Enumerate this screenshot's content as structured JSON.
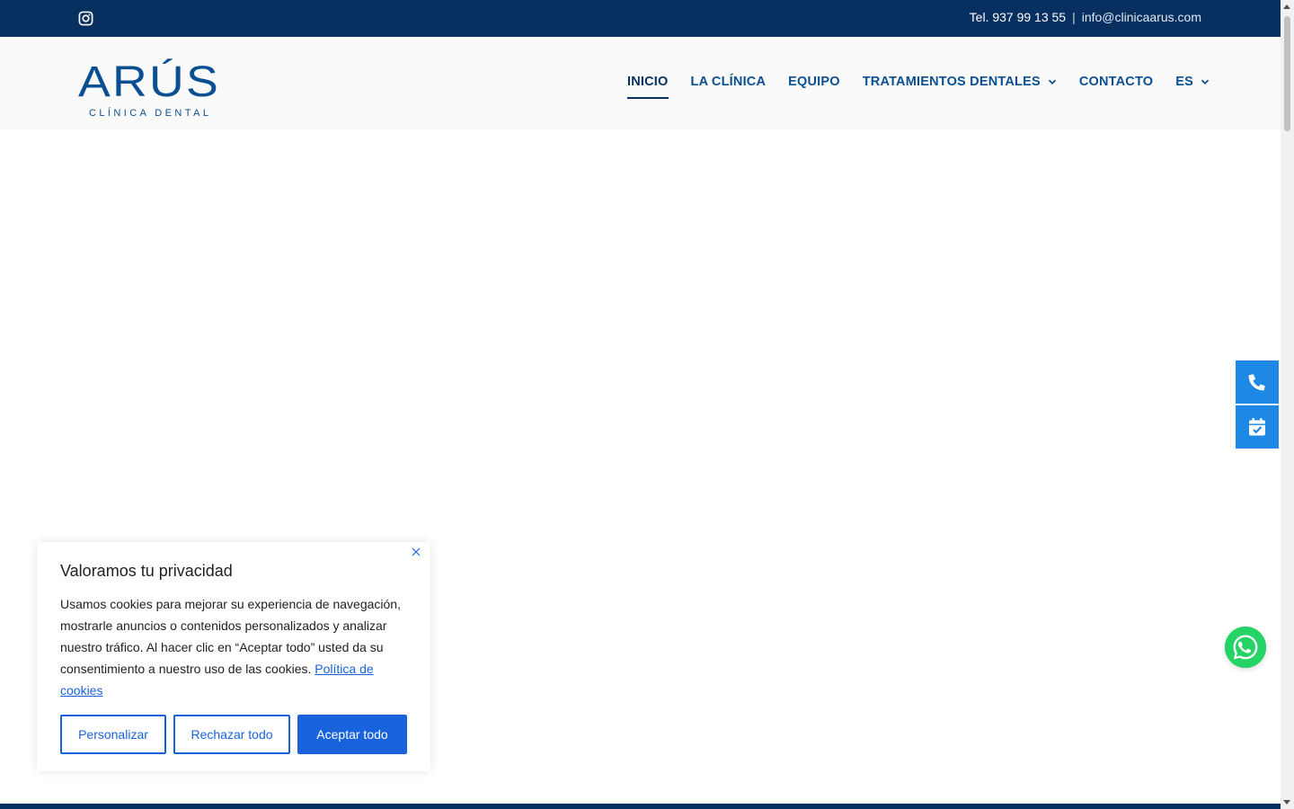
{
  "topbar": {
    "phone": "Tel. 937 99 13 55",
    "separator": "|",
    "email": "info@clinicaarus.com",
    "social_icon": "instagram-icon"
  },
  "header": {
    "logo_text": "ARÚS",
    "logo_subtext": "CLÍNICA DENTAL",
    "nav": [
      {
        "label": "INICIO",
        "active": true
      },
      {
        "label": "LA CLÍNICA"
      },
      {
        "label": "EQUIPO"
      },
      {
        "label": "TRATAMIENTOS DENTALES",
        "dropdown": true
      },
      {
        "label": "CONTACTO"
      },
      {
        "label": "ES",
        "dropdown": true
      }
    ]
  },
  "floating": {
    "phone_icon": "phone-icon",
    "calendar_icon": "calendar-check-icon",
    "whatsapp_icon": "whatsapp-icon"
  },
  "cookie": {
    "title": "Valoramos tu privacidad",
    "text": "Usamos cookies para mejorar su experiencia de navegación, mostrarle anuncios o contenidos personalizados y analizar nuestro tráfico. Al hacer clic en “Aceptar todo” usted da su consentimiento a nuestro uso de las cookies.",
    "link": "Política de cookies",
    "buttons": {
      "customize": "Personalizar",
      "reject": "Rechazar todo",
      "accept": "Aceptar todo"
    }
  },
  "colors": {
    "navy": "#072f5f",
    "nav_blue": "#0b4f93",
    "accent_blue": "#1e88e5",
    "cookie_blue": "#1863dc",
    "whatsapp": "#25d366"
  }
}
